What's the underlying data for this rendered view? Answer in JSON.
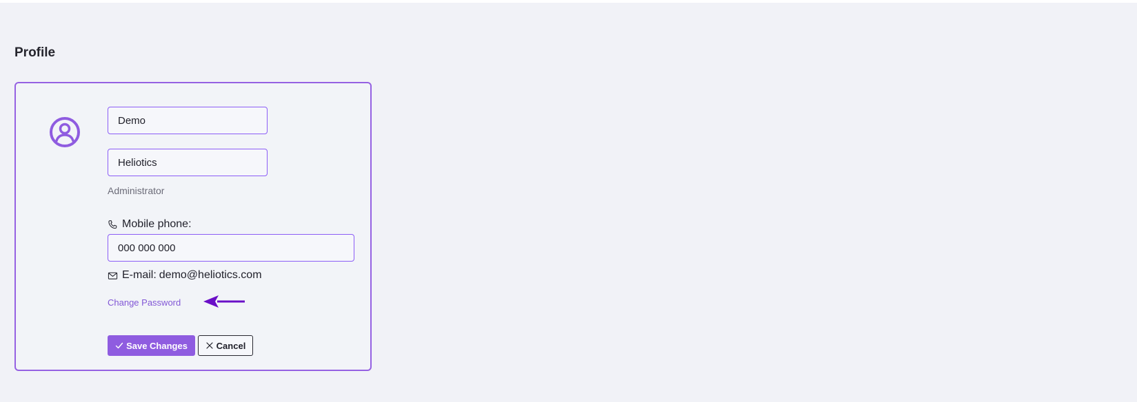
{
  "page": {
    "title": "Profile"
  },
  "profile": {
    "first_name": "Demo",
    "last_name": "Heliotics",
    "role": "Administrator",
    "phone_label": "Mobile phone:",
    "phone_value": "000 000 000",
    "email_label": "E-mail:",
    "email_value": "demo@heliotics.com",
    "change_password_label": "Change Password"
  },
  "actions": {
    "save_label": "Save Changes",
    "cancel_label": "Cancel"
  },
  "icons": {
    "avatar": "user-circle-icon",
    "phone": "phone-icon",
    "email": "mail-icon",
    "save": "check-icon",
    "cancel": "x-icon",
    "annotation": "arrow-left-icon"
  },
  "colors": {
    "accent": "#8f5ce0",
    "card_border": "#9561e2",
    "link": "#8257d6",
    "annotation_arrow": "#6a0fc7",
    "page_background": "#f1f2f7"
  }
}
